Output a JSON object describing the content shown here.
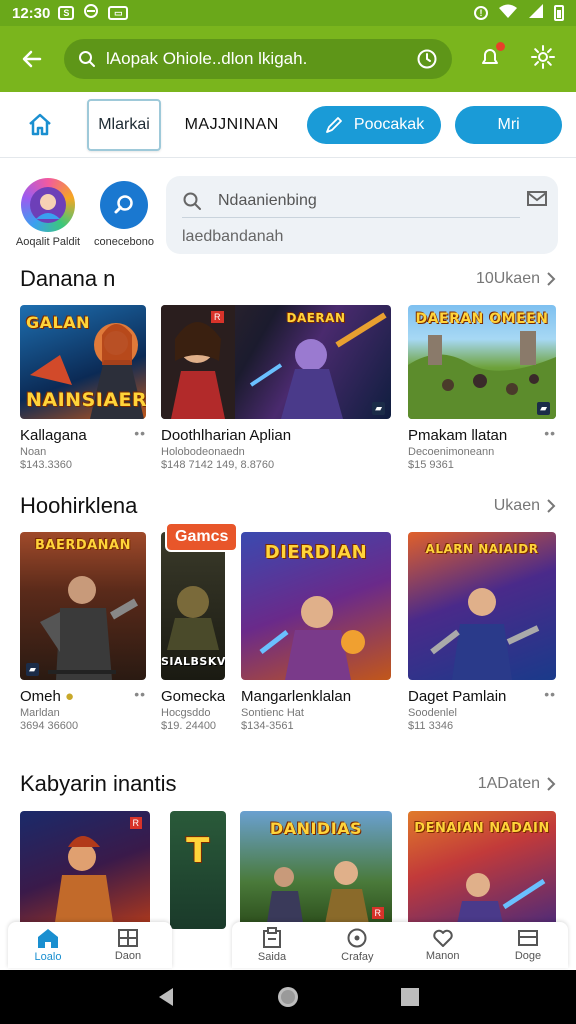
{
  "status": {
    "time": "12:30"
  },
  "app_bar": {
    "search_text": "lAopak Ohiole..dlon lkigah."
  },
  "tabs": {
    "boxed": "Mlarkai",
    "plain": "MAJJNINAN",
    "pill_a": "Poocakak",
    "pill_b": "Mri"
  },
  "shortcuts": [
    {
      "label": "Aoqalit Paldit"
    },
    {
      "label": "conecebono"
    }
  ],
  "search_card": {
    "input": "Ndaanienbing",
    "hint": "laedbandanah"
  },
  "sections": [
    {
      "title": "Danana n",
      "more": "10Ukaen",
      "cards": [
        {
          "title": "Kallagana",
          "sub": "Noan",
          "price": "$143.3360",
          "art": "GALAN NAINSIAER"
        },
        {
          "title": "Doothlharian Aplian",
          "sub": "Holobodeonaedn",
          "price": "$148 7142 149, 8.8760",
          "art": ""
        },
        {
          "title": "Pmakam llatan",
          "sub": "Decoenimoneann",
          "price": "$15 9361",
          "art": "DAERAN OMEEN"
        }
      ]
    },
    {
      "title": "Hoohirklena",
      "more": "Ukaen",
      "cards": [
        {
          "title": "Omeh",
          "sub": "Marldan",
          "price": "3694 36600",
          "art": "BAERDANAN"
        },
        {
          "title": "Gomecka",
          "sub": "Hocgsddo",
          "price": "$19. 24400",
          "art": "SIALBSKV",
          "badge": "Gamcs"
        },
        {
          "title": "Mangarlenklalan",
          "sub": "Sontienc Hat",
          "price": "$134-3561",
          "art": "DIERDIAN"
        },
        {
          "title": "Daget Pamlain",
          "sub": "Soodenlel",
          "price": "$11 3346",
          "art": "ALARN NAIAIDR"
        }
      ]
    },
    {
      "title": "Kabyarin inantis",
      "more": "1ADaten",
      "cards": [
        {
          "art": ""
        },
        {
          "art": "T"
        },
        {
          "art": "DANIDIAS"
        },
        {
          "art": "DENAIAN NADAIN"
        }
      ]
    }
  ],
  "bottom_nav": [
    {
      "label": "Loalo",
      "icon": "home-icon"
    },
    {
      "label": "Daon",
      "icon": "grid-icon"
    },
    {
      "label": "Saida",
      "icon": "clipboard-icon"
    },
    {
      "label": "Crafay",
      "icon": "target-icon"
    },
    {
      "label": "Manon",
      "icon": "heart-icon"
    },
    {
      "label": "Doge",
      "icon": "list-icon"
    }
  ],
  "colors": {
    "status_bar": "#6aa81a",
    "app_bar": "#7ab51d",
    "accent": "#1a9bd7"
  }
}
